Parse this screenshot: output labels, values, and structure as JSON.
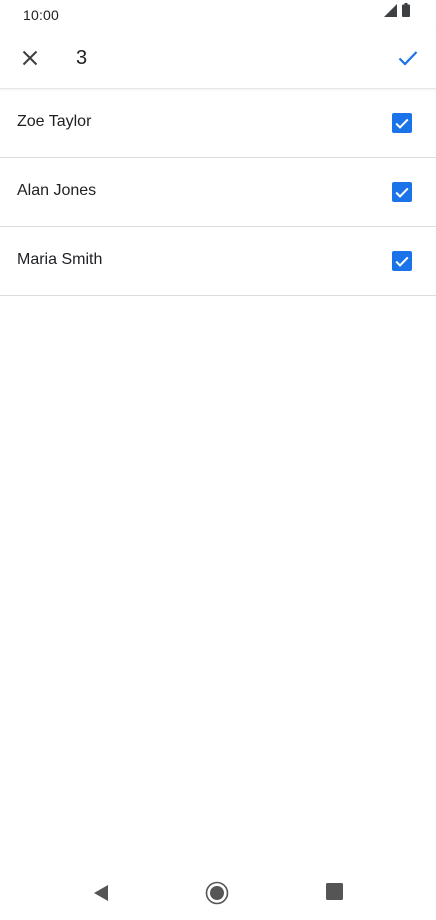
{
  "status_bar": {
    "time": "10:00",
    "icons": [
      "cellular-signal-icon",
      "battery-icon"
    ]
  },
  "app_bar": {
    "close_icon": "close-icon",
    "selected_count": "3",
    "confirm_icon": "check-icon",
    "accent_color": "#1a73e8"
  },
  "contacts": [
    {
      "name": "Zoe Taylor",
      "checked": true
    },
    {
      "name": "Alan Jones",
      "checked": true
    },
    {
      "name": "Maria Smith",
      "checked": true
    }
  ],
  "nav_bar": {
    "icons": [
      "back-icon",
      "home-icon",
      "recents-icon"
    ]
  }
}
